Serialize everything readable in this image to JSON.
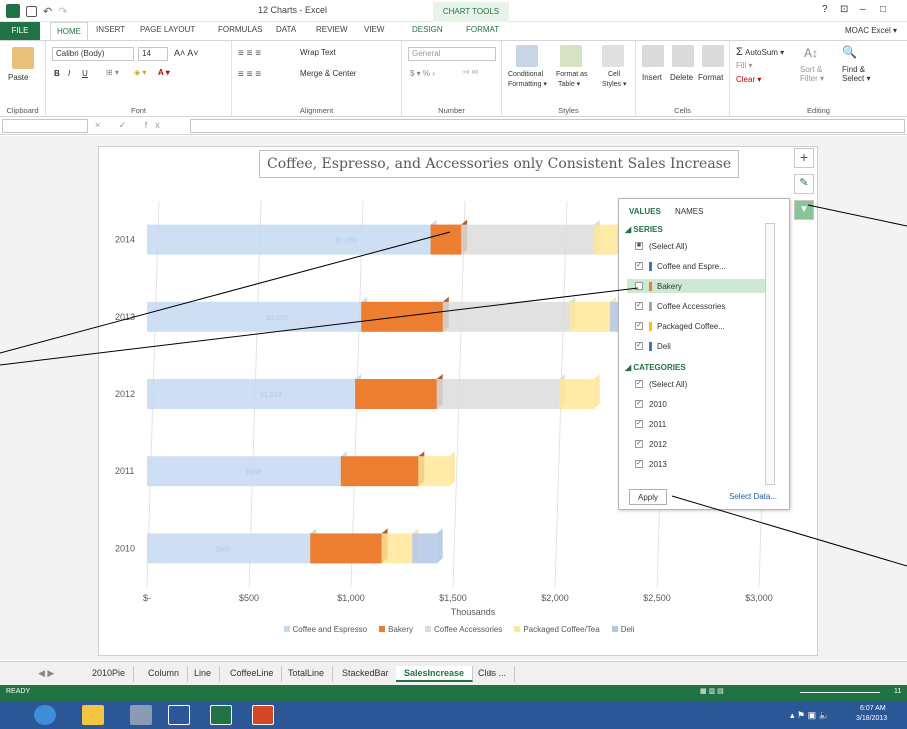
{
  "titlebar": {
    "title": "12 Charts - Excel",
    "chart_tools": "CHART TOOLS",
    "controls": [
      "?",
      "⊡",
      "–",
      "□"
    ]
  },
  "tabs": {
    "file": "FILE",
    "home": "HOME",
    "insert": "INSERT",
    "page_layout": "PAGE LAYOUT",
    "formulas": "FORMULAS",
    "data": "DATA",
    "review": "REVIEW",
    "view": "VIEW",
    "design": "DESIGN",
    "format": "FORMAT",
    "account": "MOAC Excel ▾"
  },
  "ribbon": {
    "clipboard": {
      "label": "Clipboard",
      "paste": "Paste"
    },
    "font": {
      "label": "Font",
      "family": "Calibri (Body)",
      "size": "14",
      "bold": "B",
      "italic": "I",
      "underline": "U"
    },
    "alignment": {
      "label": "Alignment",
      "wrap": "Wrap Text",
      "merge": "Merge & Center"
    },
    "number": {
      "label": "Number",
      "format": "General",
      "currency": "$ ▾ % ›",
      "decimals": "⁺⁰ ⁰⁰"
    },
    "styles": {
      "label": "Styles",
      "conditional": "Conditional",
      "conditional2": "Formatting ▾",
      "format_as": "Format as",
      "format_as2": "Table ▾",
      "cell": "Cell",
      "cell2": "Styles ▾"
    },
    "cells": {
      "label": "Cells",
      "insert": "Insert",
      "delete": "Delete",
      "format": "Format"
    },
    "editing": {
      "label": "Editing",
      "autosum": "AutoSum ▾",
      "fill": "Fill ▾",
      "clear": "Clear ▾",
      "sort": "Sort &",
      "sort2": "Filter ▾",
      "find": "Find &",
      "find2": "Select ▾"
    }
  },
  "formula_bar": {
    "fx": "×  ✓  fx",
    "value": ""
  },
  "chart": {
    "title": "Coffee, Espresso, and Accessories only Consistent Sales Increase",
    "x_axis_title": "Thousands"
  },
  "chart_data": {
    "type": "bar",
    "title": "Coffee, Espresso, and Accessories only Consistent Sales Increase",
    "xlabel": "Thousands",
    "ylabel": "",
    "stacked": true,
    "orientation": "horizontal",
    "categories": [
      "2010",
      "2011",
      "2012",
      "2013",
      "2014"
    ],
    "xlim": [
      0,
      3000
    ],
    "x_ticks": [
      "$-",
      "$500",
      "$1,000",
      "$1,500",
      "$2,000",
      "$2,500",
      "$3,000"
    ],
    "series": [
      {
        "name": "Coffee and Espresso",
        "color": "#c5d9f1",
        "values": [
          800,
          950,
          1020,
          1050,
          1390
        ]
      },
      {
        "name": "Bakery",
        "color": "#ed7d31",
        "values": [
          350,
          380,
          400,
          400,
          150
        ]
      },
      {
        "name": "Coffee Accessories",
        "color": "#dcdcdc",
        "values": [
          0,
          0,
          600,
          620,
          650
        ]
      },
      {
        "name": "Packaged Coffee/Tea",
        "color": "#ffe699",
        "values": [
          150,
          150,
          170,
          200,
          150
        ]
      },
      {
        "name": "Deli",
        "color": "#b4c7e7",
        "values": [
          120,
          0,
          0,
          180,
          0
        ]
      }
    ],
    "data_labels": [
      {
        "category": "2014",
        "text": "$1,389"
      },
      {
        "category": "2013",
        "text": "$1,070"
      },
      {
        "category": "2012",
        "text": "$1,013"
      },
      {
        "category": "2011",
        "text": "$958"
      },
      {
        "category": "2010",
        "text": "$800"
      }
    ],
    "legend": [
      "Coffee and Espresso",
      "Bakery",
      "Coffee Accessories",
      "Packaged Coffee/Tea",
      "Deli"
    ],
    "legend_position": "bottom",
    "grid": true
  },
  "filter_panel": {
    "tab_values": "VALUES",
    "tab_names": "NAMES",
    "series_head": "SERIES",
    "series_items": [
      {
        "label": "(Select All)",
        "checked": "■"
      },
      {
        "label": "Coffee and Espre...",
        "checked": "✓",
        "color": "#4472c4"
      },
      {
        "label": "Bakery",
        "checked": "",
        "color": "#ed7d31"
      },
      {
        "label": "Coffee Accessories",
        "checked": "✓",
        "color": "#a5a5a5"
      },
      {
        "label": "Packaged Coffee...",
        "checked": "✓",
        "color": "#ffc000"
      },
      {
        "label": "Deli",
        "checked": "✓",
        "color": "#4472c4"
      }
    ],
    "categories_head": "CATEGORIES",
    "category_items": [
      {
        "label": "(Select All)",
        "checked": "✓"
      },
      {
        "label": "2010",
        "checked": "✓"
      },
      {
        "label": "2011",
        "checked": "✓"
      },
      {
        "label": "2012",
        "checked": "✓"
      },
      {
        "label": "2013",
        "checked": "✓"
      }
    ],
    "apply": "Apply",
    "select_data": "Select Data..."
  },
  "chart_buttons": {
    "add": "+",
    "style": "✎",
    "filter": "▼"
  },
  "sheet_tabs": {
    "nav": "◀  ▶",
    "tabs": [
      "2010Pie",
      "Column",
      "Line",
      "CoffeeLine",
      "TotalLine",
      "StackedBar",
      "SalesIncrease",
      "Clus ..."
    ],
    "active": "SalesIncrease",
    "add": "⊕"
  },
  "status": {
    "ready": "READY",
    "zoom": "11"
  },
  "taskbar": {
    "time": "6:07 AM",
    "date": "3/18/2013"
  }
}
